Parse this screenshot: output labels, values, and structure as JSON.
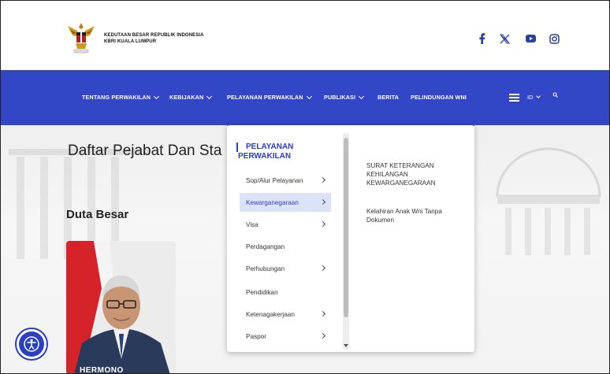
{
  "header": {
    "brand_line1": "KEDUTAAN BESAR REPUBLIK INDONESIA",
    "brand_line2": "KBRI KUALA LUMPUR",
    "social": [
      "facebook-icon",
      "x-icon",
      "youtube-icon",
      "instagram-icon"
    ]
  },
  "nav": {
    "items": [
      {
        "label": "TENTANG PERWAKILAN",
        "has_dropdown": true
      },
      {
        "label": "KEBIJAKAN",
        "has_dropdown": true
      },
      {
        "label": "PELAYANAN PERWAKILAN",
        "has_dropdown": true
      },
      {
        "label": "PUBLIKASI",
        "has_dropdown": true
      },
      {
        "label": "BERITA",
        "has_dropdown": false
      },
      {
        "label": "PELINDUNGAN WNI",
        "has_dropdown": false
      }
    ],
    "language": "ID",
    "colors": {
      "nav_bg": "#3346c8",
      "accent": "#2b3fc2"
    }
  },
  "hero": {
    "page_title": "Daftar Pejabat Dan Sta",
    "section_title": "Duta Besar",
    "person_name": "HERMONO"
  },
  "dropdown": {
    "heading_line1": "PELAYANAN",
    "heading_line2": "PERWAKILAN",
    "items": [
      {
        "label": "Sop/Alur Pelayanan",
        "arrow": true
      },
      {
        "label": "Kewarganegaraan",
        "arrow": true,
        "active": true
      },
      {
        "label": "Visa",
        "arrow": true
      },
      {
        "label": "Perdagangan",
        "arrow": false
      },
      {
        "label": "Perhubungan",
        "arrow": true
      },
      {
        "label": "Pendidikan",
        "arrow": false
      },
      {
        "label": "Ketenagakerjaan",
        "arrow": true
      },
      {
        "label": "Paspor",
        "arrow": true
      }
    ],
    "submenu": [
      {
        "label": "SURAT KETERANGAN KEHILANGAN KEWARGANEGARAAN"
      },
      {
        "label": "Kelahiran Anak Wni Tanpa Dokumen"
      }
    ]
  }
}
